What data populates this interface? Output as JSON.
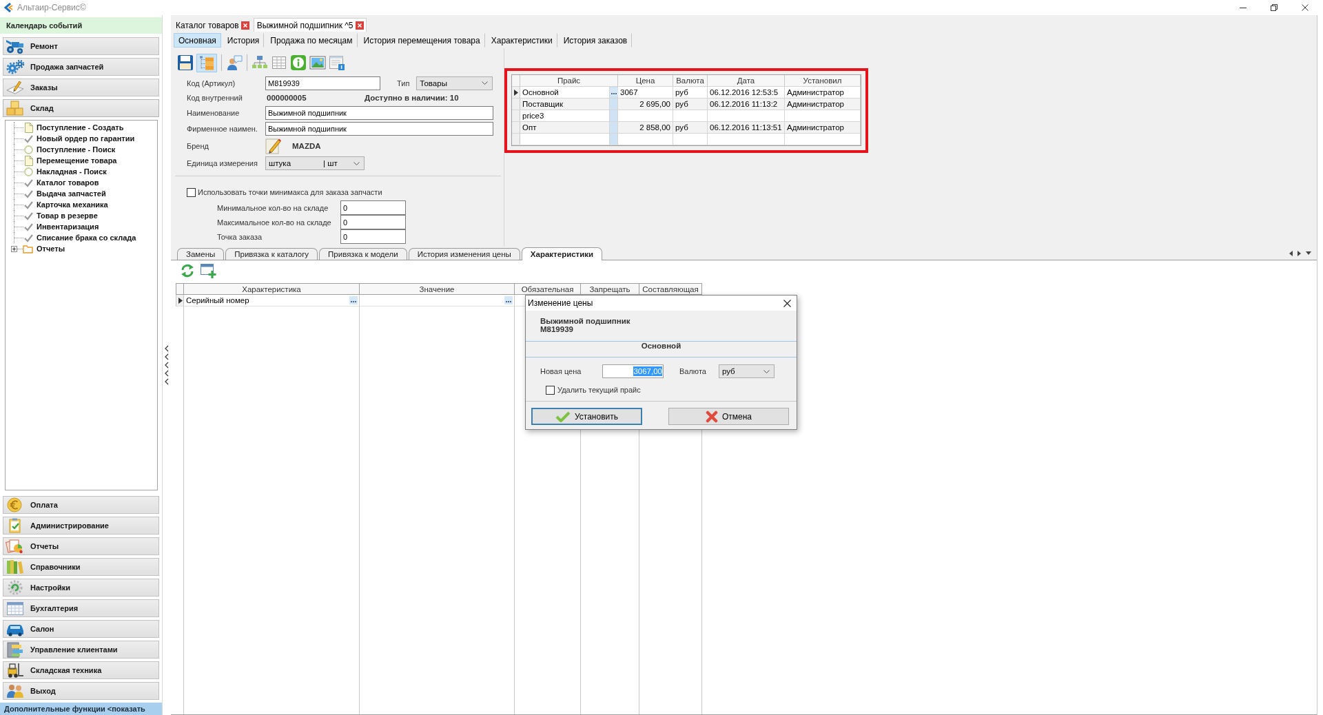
{
  "window": {
    "title": "Альтаир-Сервис©"
  },
  "sidebar": {
    "header": "Календарь событий",
    "sections": [
      {
        "label": "Ремонт",
        "expanded": false
      },
      {
        "label": "Продажа запчастей",
        "expanded": false
      },
      {
        "label": "Заказы",
        "expanded": false
      },
      {
        "label": "Склад",
        "expanded": true,
        "children": [
          {
            "label": "Поступление - Создать",
            "kind": "document"
          },
          {
            "label": "Новый ордер по гарантии",
            "kind": "check"
          },
          {
            "label": "Поступление - Поиск",
            "kind": "search"
          },
          {
            "label": "Перемещение товара",
            "kind": "document"
          },
          {
            "label": "Накладная - Поиск",
            "kind": "search"
          },
          {
            "label": "Каталог товаров",
            "kind": "check"
          },
          {
            "label": "Выдача запчастей",
            "kind": "check"
          },
          {
            "label": "Карточка механика",
            "kind": "check"
          },
          {
            "label": "Товар в резерве",
            "kind": "check"
          },
          {
            "label": "Инвентаризация",
            "kind": "check"
          },
          {
            "label": "Списание брака со склада",
            "kind": "check"
          },
          {
            "label": "Отчеты",
            "kind": "folder",
            "expanded": false
          }
        ]
      },
      {
        "label": "Оплата",
        "expanded": false
      },
      {
        "label": "Администрирование",
        "expanded": false
      },
      {
        "label": "Отчеты",
        "expanded": false
      },
      {
        "label": "Справочники",
        "expanded": false
      },
      {
        "label": "Настройки",
        "expanded": false
      },
      {
        "label": "Бухгалтерия",
        "expanded": false
      },
      {
        "label": "Салон",
        "expanded": false
      },
      {
        "label": "Управление клиентами",
        "expanded": false
      },
      {
        "label": "Складская техника",
        "expanded": false
      },
      {
        "label": "Выход",
        "expanded": false
      }
    ],
    "footer": "Дополнительные функции <показать"
  },
  "document_tabs": [
    {
      "label": "Каталог товаров",
      "selected": false
    },
    {
      "label": "Выжимной подшипник ^5",
      "selected": true
    }
  ],
  "page_tabs": [
    {
      "label": "Основная",
      "selected": true
    },
    {
      "label": "История",
      "selected": false
    },
    {
      "label": "Продажа по месяцам",
      "selected": false
    },
    {
      "label": "История перемещения товара",
      "selected": false
    },
    {
      "label": "Характеристики",
      "selected": false
    },
    {
      "label": "История заказов",
      "selected": false
    }
  ],
  "toolbar": {
    "groups": [
      [
        {
          "pressed": false
        },
        {
          "pressed": true
        }
      ],
      [
        {
          "pressed": false
        }
      ],
      [
        {
          "pressed": false
        },
        {
          "pressed": false
        },
        {
          "pressed": false
        },
        {
          "pressed": false
        },
        {
          "pressed": false
        }
      ]
    ]
  },
  "form": {
    "article": {
      "label": "Код (Артикул)",
      "value": "M819939"
    },
    "type": {
      "label": "Тип",
      "value": "Товары"
    },
    "internal_code": {
      "label": "Код внутренний",
      "value": "000000005"
    },
    "availability": "Доступно в наличии: 10",
    "name": {
      "label": "Наименование",
      "value": "Выжимной подшипник"
    },
    "brand_name": {
      "label": "Фирменное наимен.",
      "value": "Выжимной подшипник"
    },
    "brand": {
      "label": "Бренд",
      "value": "MAZDA"
    },
    "unit": {
      "label": "Единица измерения",
      "value": "штука",
      "abbreviation": "| шт"
    },
    "minimax": {
      "label": "Использовать точки минимакса для заказа запчасти",
      "checked": false,
      "fields": [
        {
          "label": "Минимальное кол-во на складе",
          "value": "0"
        },
        {
          "label": "Максимальное кол-во на складе",
          "value": "0"
        },
        {
          "label": "Точка заказа",
          "value": "0"
        }
      ]
    }
  },
  "price_table": {
    "highlighted": true,
    "columns": [
      "Прайс",
      "Цена",
      "Валюта",
      "Дата",
      "Установил"
    ],
    "rows": [
      {
        "selected": true,
        "editing": true,
        "price_list": "Основной",
        "price": "3067",
        "currency": "руб",
        "date": "06.12.2016 12:53:5",
        "set_by": "Администратор"
      },
      {
        "selected": false,
        "editing": false,
        "price_list": "Поставщик",
        "price": "2 695,00",
        "currency": "руб",
        "date": "06.12.2016 11:13:2",
        "set_by": "Администратор"
      },
      {
        "selected": false,
        "editing": false,
        "price_list": "price3"
      },
      {
        "selected": false,
        "editing": false,
        "price_list": "Опт",
        "price": "2 858,00",
        "currency": "руб",
        "date": "06.12.2016 11:13:51",
        "set_by": "Администратор"
      }
    ]
  },
  "characteristics": {
    "tabs": [
      {
        "label": "Замены",
        "selected": false
      },
      {
        "label": "Привязка к каталогу",
        "selected": false
      },
      {
        "label": "Привязка к модели",
        "selected": false
      },
      {
        "label": "История изменения цены",
        "selected": false
      },
      {
        "label": "Характеристики",
        "selected": true
      }
    ],
    "columns": [
      "Характеристика",
      "Значение",
      "Обязательная",
      "Запрещать",
      "Составляющая"
    ],
    "rows": [
      {
        "selected": true,
        "characteristic": "Серийный номер"
      }
    ]
  },
  "dialog": {
    "title": "Изменение цены",
    "product_name": "Выжимной подшипник",
    "article": "M819939",
    "price_list": "Основной",
    "new_price": {
      "label": "Новая цена",
      "value": "3067,00",
      "text_selected": true
    },
    "currency": {
      "label": "Валюта",
      "value": "руб"
    },
    "delete_price": {
      "label": "Удалить текущий прайс",
      "checked": false
    },
    "buttons": [
      {
        "label": "Установить",
        "kind": "confirm",
        "focused": true
      },
      {
        "label": "Отмена",
        "kind": "cancel",
        "focused": false
      }
    ]
  }
}
